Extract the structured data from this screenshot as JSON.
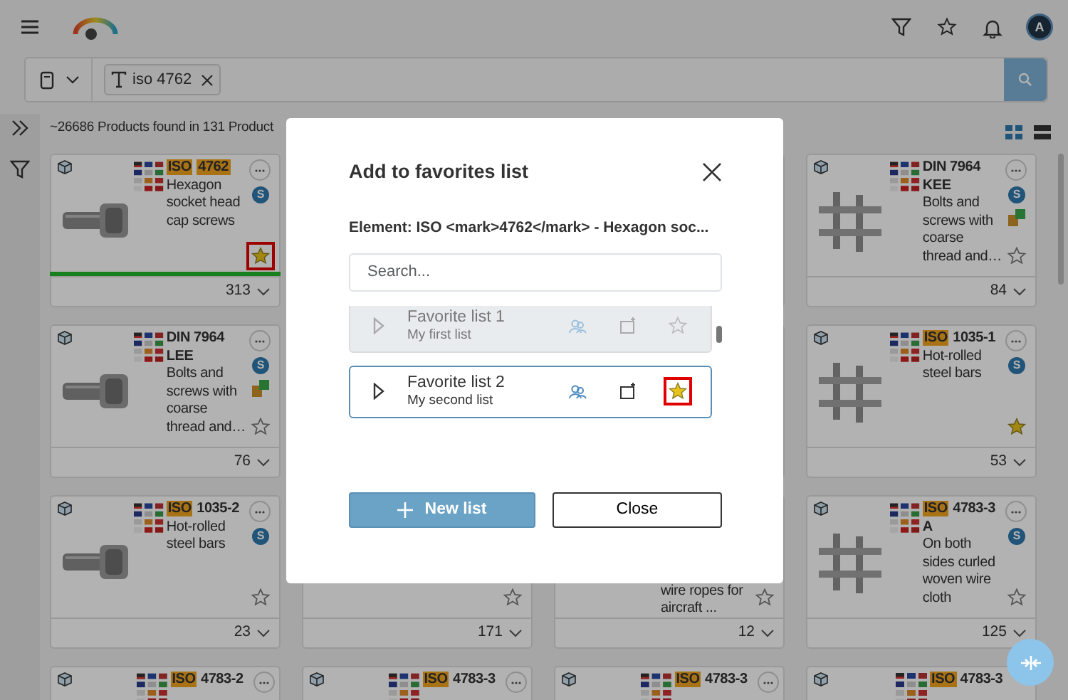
{
  "header": {
    "avatar_initial": "A"
  },
  "search": {
    "chips": [
      {
        "label": "iso 4762"
      }
    ]
  },
  "results": {
    "summary": "~26686 Products found in 131 Product",
    "views": [
      {
        "kind": "grid",
        "selected": true
      },
      {
        "kind": "list",
        "selected": false
      }
    ]
  },
  "rows": [
    [
      {
        "title_parts": [
          {
            "text": "ISO",
            "highlight": true
          },
          {
            "text": "4762",
            "highlight": true
          }
        ],
        "description": "Hexagon socket head cap screws",
        "badge": "S",
        "variants": false,
        "favorite": true,
        "marked": true,
        "loaded": true,
        "count": "313"
      },
      null,
      null,
      {
        "title_parts": [
          {
            "text": "DIN 7964 KEE",
            "highlight": false
          }
        ],
        "description": "Bolts and screws with coarse thread and…",
        "badge": "S",
        "variants": true,
        "favorite": false,
        "marked": false,
        "loaded": false,
        "count": "84"
      }
    ],
    [
      {
        "title_parts": [
          {
            "text": "DIN 7964 LEE",
            "highlight": false
          }
        ],
        "description": "Bolts and screws with coarse thread and…",
        "badge": "S",
        "variants": true,
        "favorite": false,
        "marked": false,
        "loaded": false,
        "count": "76"
      },
      null,
      null,
      {
        "title_parts": [
          {
            "text": "ISO",
            "highlight": true
          },
          {
            "text": "1035-1",
            "highlight": false
          }
        ],
        "description": "Hot-rolled steel bars",
        "badge": "S",
        "variants": false,
        "favorite": true,
        "marked": false,
        "loaded": false,
        "count": "53"
      }
    ],
    [
      {
        "title_parts": [
          {
            "text": "ISO",
            "highlight": true
          },
          {
            "text": "1035-2",
            "highlight": false
          }
        ],
        "description": "Hot-rolled steel bars",
        "badge": "S",
        "variants": false,
        "favorite": false,
        "marked": false,
        "loaded": false,
        "count": "23"
      },
      {
        "favorite": false,
        "marked": false,
        "count": "171"
      },
      {
        "description": "wire ropes for aircraft ...",
        "favorite": false,
        "marked": false,
        "count": "12"
      },
      {
        "title_parts": [
          {
            "text": "ISO",
            "highlight": true
          },
          {
            "text": "4783-3 A",
            "highlight": false
          }
        ],
        "description": "On both sides curled woven wire cloth",
        "badge": "S",
        "variants": false,
        "favorite": false,
        "marked": false,
        "loaded": false,
        "count": "125"
      }
    ],
    [
      {
        "title_parts": [
          {
            "text": "ISO",
            "highlight": true
          },
          {
            "text": "4783-2",
            "highlight": false
          }
        ]
      },
      {
        "title_parts": [
          {
            "text": "ISO",
            "highlight": true
          },
          {
            "text": "4783-3",
            "highlight": false
          }
        ]
      },
      {
        "title_parts": [
          {
            "text": "ISO",
            "highlight": true
          },
          {
            "text": "4783-3",
            "highlight": false
          }
        ]
      },
      {
        "title_parts": [
          {
            "text": "ISO",
            "highlight": true
          },
          {
            "text": "4783-3",
            "highlight": false
          }
        ],
        "more_button": false
      }
    ]
  ],
  "modal": {
    "title": "Add to favorites list",
    "element_label": "Element: ISO <mark>4762</mark> - Hexagon soc...",
    "search_placeholder": "Search...",
    "lists": [
      {
        "name": "Favorite list 1",
        "description": "My first list",
        "selected": false,
        "disabled": true,
        "favorite": false,
        "marked": false
      },
      {
        "name": "Favorite list 2",
        "description": "My second list",
        "selected": true,
        "disabled": false,
        "favorite": true,
        "marked": true
      }
    ],
    "buttons": [
      {
        "kind": "primary",
        "label": "New list"
      },
      {
        "kind": "secondary",
        "label": "Close"
      }
    ]
  }
}
